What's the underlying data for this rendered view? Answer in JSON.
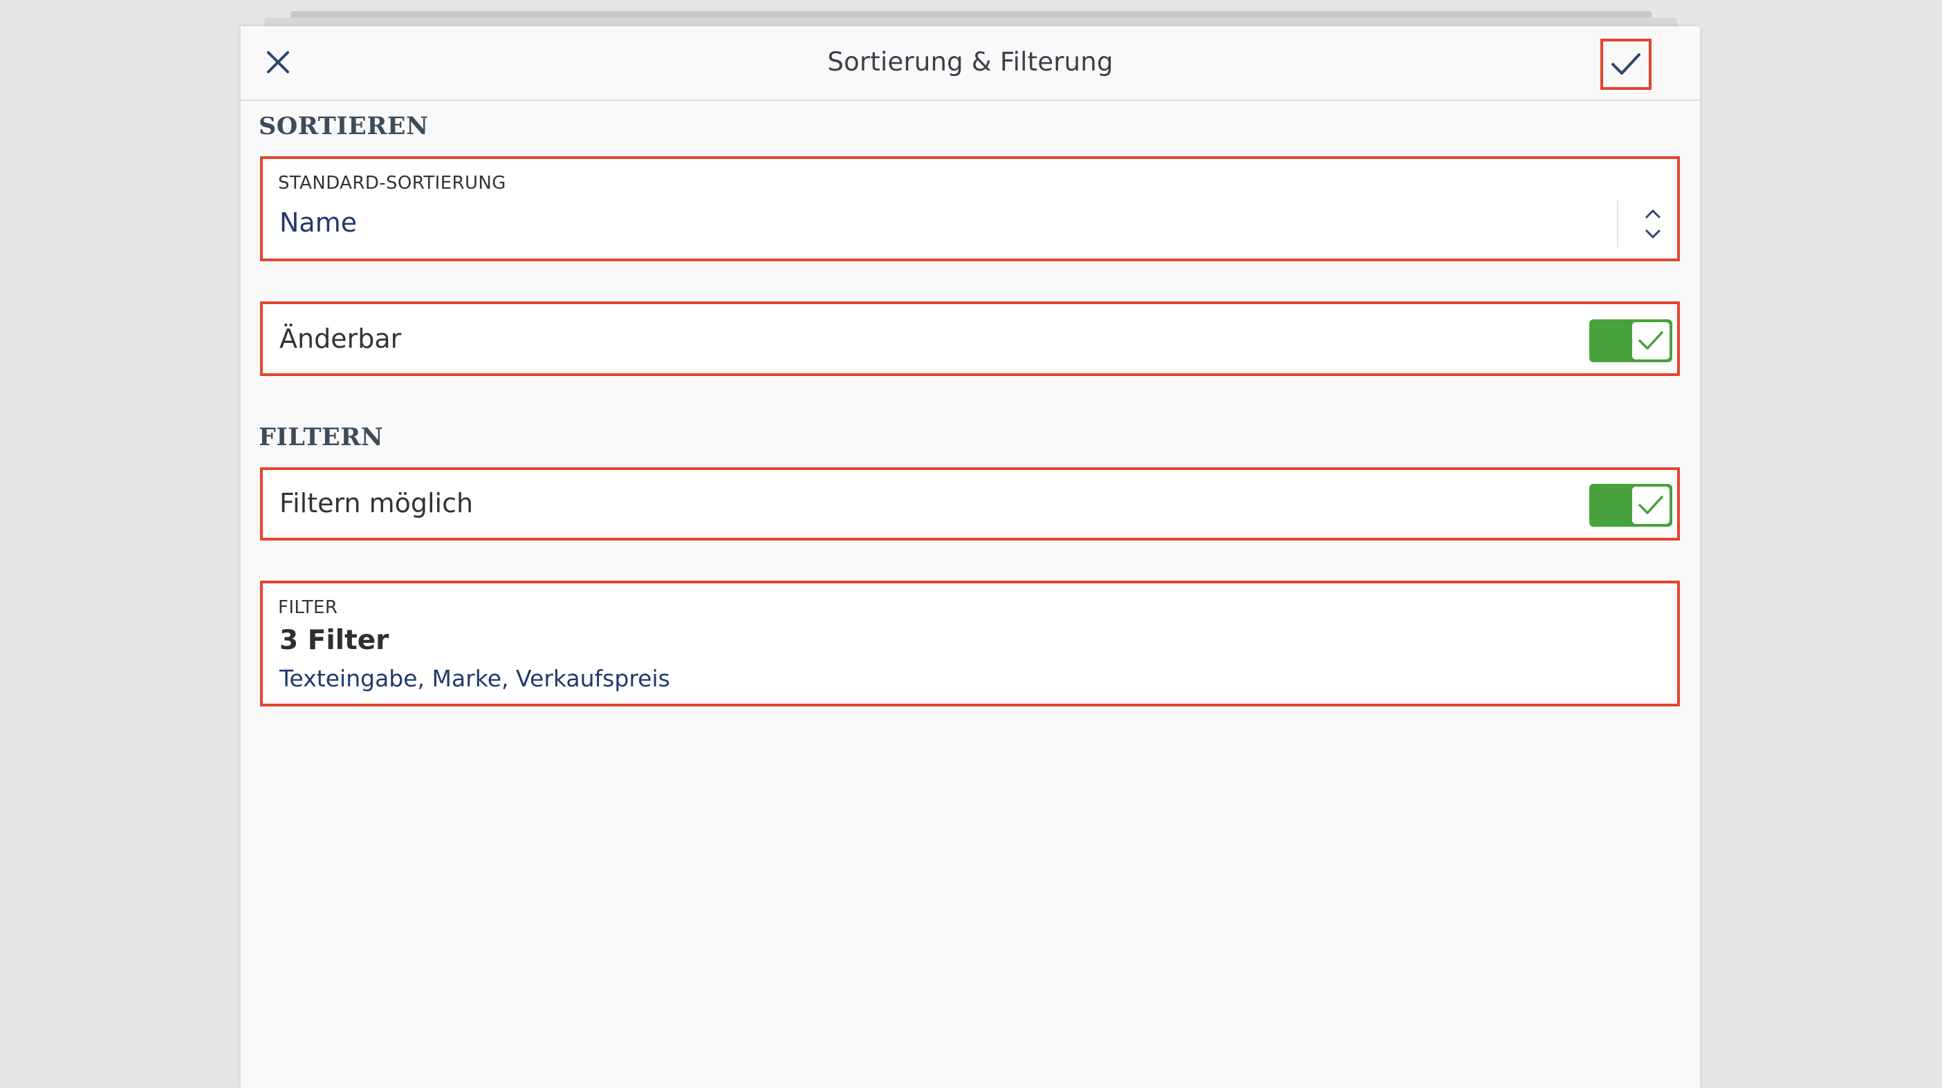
{
  "header": {
    "title": "Sortierung & Filterung",
    "close_icon": "close-icon",
    "confirm_icon": "checkmark-icon"
  },
  "sort_section": {
    "title": "SORTIEREN",
    "standard_sort": {
      "label": "STANDARD-SORTIERUNG",
      "value": "Name",
      "icon": "up-down-stepper-icon"
    },
    "changeable": {
      "label": "Änderbar",
      "enabled": true
    }
  },
  "filter_section": {
    "title": "FILTERN",
    "filtering_possible": {
      "label": "Filtern möglich",
      "enabled": true
    },
    "filter": {
      "label": "FILTER",
      "count": "3 Filter",
      "summary": "Texteingabe, Marke, Verkaufspreis"
    }
  },
  "colors": {
    "accent_highlight": "#e2452f",
    "toggle_on": "#47a23b",
    "value_text": "#1f3a6b",
    "icon": "#2c4470"
  }
}
